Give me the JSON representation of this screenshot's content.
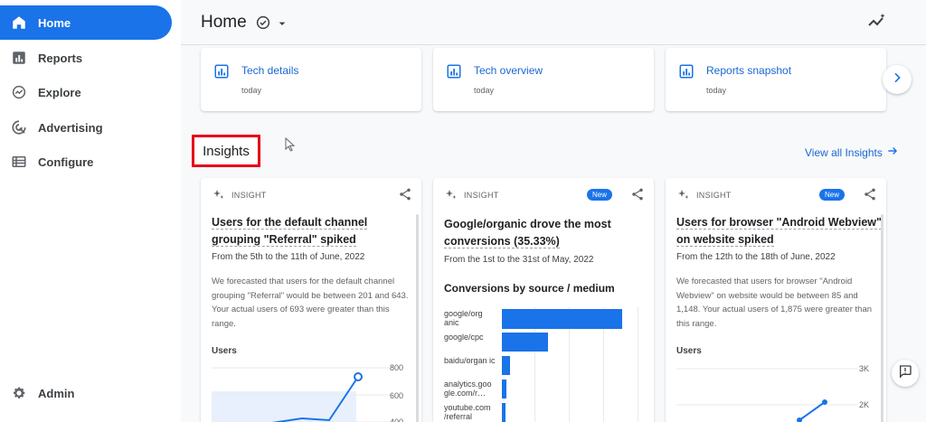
{
  "sidebar": {
    "items": [
      {
        "label": "Home",
        "icon": "home-icon",
        "active": true
      },
      {
        "label": "Reports",
        "icon": "reports-icon",
        "active": false
      },
      {
        "label": "Explore",
        "icon": "explore-icon",
        "active": false
      },
      {
        "label": "Advertising",
        "icon": "advertising-icon",
        "active": false
      },
      {
        "label": "Configure",
        "icon": "configure-icon",
        "active": false
      }
    ],
    "admin": {
      "label": "Admin",
      "icon": "gear-icon"
    }
  },
  "header": {
    "title": "Home"
  },
  "report_cards": [
    {
      "title": "Tech details",
      "date": "today"
    },
    {
      "title": "Tech overview",
      "date": "today"
    },
    {
      "title": "Reports snapshot",
      "date": "today"
    }
  ],
  "insights": {
    "heading": "Insights",
    "view_all": "View all Insights",
    "cards": [
      {
        "kicker": "INSIGHT",
        "badge": "",
        "title_part1": "Users for the default channel",
        "title_part2": "grouping \"Referral\" spiked",
        "date": "From the 5th to the 11th of June, 2022",
        "description": "We forecasted that users for the default channel grouping \"Referral\" would be between 201 and 643. Your actual users of 693 were greater than this range.",
        "metric": "Users",
        "axis": [
          "800",
          "600",
          "400"
        ]
      },
      {
        "kicker": "INSIGHT",
        "badge": "New",
        "title_part1": "Google/organic drove the most",
        "title_part2": "conversions (35.33%)",
        "date": "From the 1st to the 31st of May, 2022",
        "breakdown_title": "Conversions by source / medium",
        "bars": [
          {
            "label": "google/org anic",
            "value": 35.33
          },
          {
            "label": "google/cpc",
            "value": 13.5
          },
          {
            "label": "baidu/organ ic",
            "value": 2.3
          },
          {
            "label": "analytics.goo gle.com/r…",
            "value": 1.4
          },
          {
            "label": "youtube.com /referral",
            "value": 1.1
          }
        ]
      },
      {
        "kicker": "INSIGHT",
        "badge": "New",
        "title_part1": "Users for browser \"Android Webview\"",
        "title_part2": "on website spiked",
        "date": "From the 12th to the 18th of June, 2022",
        "description": "We forecasted that users for browser \"Android Webview\" on website would be between 85 and 1,148. Your actual users of 1,875 were greater than this range.",
        "metric": "Users",
        "axis": [
          "3K",
          "2K"
        ]
      }
    ]
  },
  "colors": {
    "accent": "#1a73e8",
    "link": "#1967d2",
    "highlight_box": "#e6001a"
  }
}
